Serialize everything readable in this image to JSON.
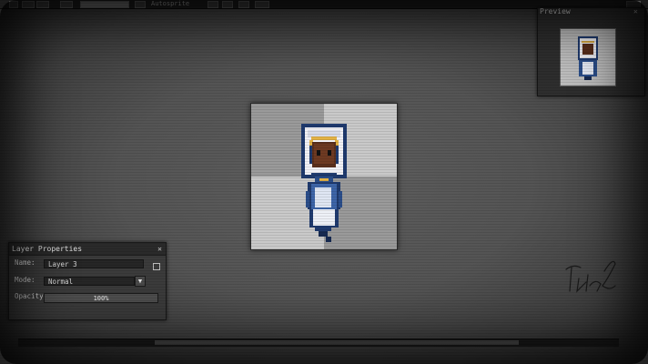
{
  "toolbar": {
    "document_title": "Autosprite",
    "buttons": [
      "button-1",
      "button-2",
      "button-3",
      "button-4"
    ]
  },
  "preview": {
    "title": "Preview"
  },
  "layer_properties": {
    "title": "Layer Properties",
    "name_label": "Name:",
    "name_value": "Layer 3",
    "mode_label": "Mode:",
    "mode_value": "Normal",
    "opacity_label": "Opacity:",
    "opacity_value": "100%"
  },
  "colors": {
    "panel": "#3b3b3b",
    "titlebar": "#2a2a2a",
    "sprite_blue": "#2b4e8a",
    "sprite_skin": "#5a2f1c",
    "sprite_gold": "#e3b246"
  },
  "icons": [
    "close-icon",
    "dropdown-arrow-icon",
    "lock-checkbox",
    "signature-mark"
  ]
}
